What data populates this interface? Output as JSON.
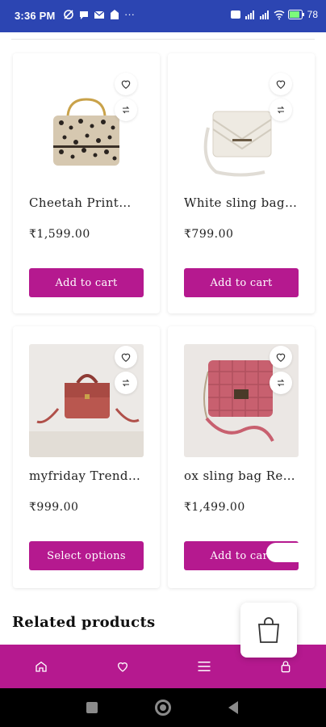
{
  "status_bar": {
    "time": "3:36 PM",
    "battery": "78"
  },
  "products": [
    {
      "title": "Cheetah Print…",
      "price": "₹1,599.00",
      "button": "Add to cart",
      "image_desc": "cheetah-bag"
    },
    {
      "title": "White sling bag…",
      "price": "₹799.00",
      "button": "Add to cart",
      "image_desc": "white-bag"
    },
    {
      "title": "myfriday Trend…",
      "price": "₹999.00",
      "button": "Select options",
      "image_desc": "red-bag"
    },
    {
      "title": "ox sling bag Re…",
      "price": "₹1,499.00",
      "button": "Add to cart",
      "image_desc": "pink-bag"
    }
  ],
  "related_heading": "Related products",
  "icons": {
    "wishlist": "heart-icon",
    "compare": "compare-icon",
    "cart": "shopping-bag-icon",
    "nav": [
      "home-icon",
      "heart-icon",
      "menu-icon",
      "lock-icon"
    ]
  },
  "colors": {
    "brand": "#b5198f",
    "status_bar": "#2c45b2"
  }
}
